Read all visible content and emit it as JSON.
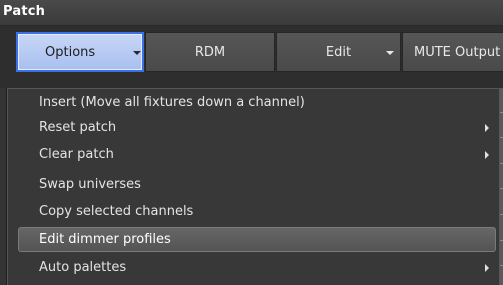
{
  "window": {
    "title": "Patch"
  },
  "toolbar": {
    "options": "Options",
    "rdm": "RDM",
    "edit": "Edit",
    "mute": "MUTE Output"
  },
  "menu": {
    "items": [
      {
        "label": "Insert (Move all fixtures down  a channel)",
        "submenu": false
      },
      {
        "label": "Reset patch",
        "submenu": true
      },
      {
        "label": "Clear patch",
        "submenu": true
      },
      {
        "label": "Swap universes",
        "submenu": false
      },
      {
        "label": "Copy selected channels",
        "submenu": false
      },
      {
        "label": "Edit dimmer profiles",
        "submenu": false,
        "highlighted": true
      },
      {
        "label": "Auto palettes",
        "submenu": true
      }
    ]
  },
  "colors": {
    "accent": "#3b71e8",
    "highlight": "#5e5e5e",
    "menu_bg": "#383838"
  }
}
